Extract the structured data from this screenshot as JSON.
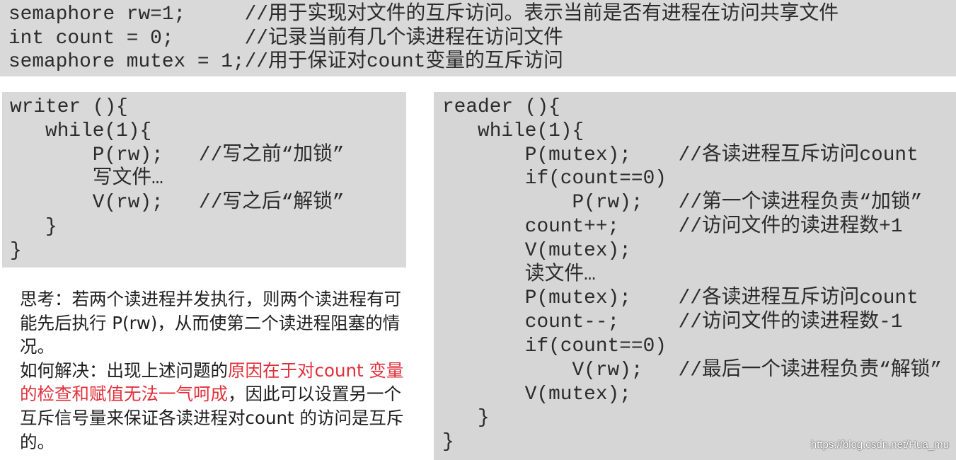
{
  "declarations": [
    "semaphore rw=1;     //用于实现对文件的互斥访问。表示当前是否有进程在访问共享文件",
    "int count = 0;      //记录当前有几个读进程在访问文件",
    "semaphore mutex = 1;//用于保证对count变量的互斥访问"
  ],
  "writer": [
    "writer (){",
    "   while(1){",
    "       P(rw);   //写之前“加锁”",
    "       写文件…",
    "       V(rw);   //写之后“解锁”",
    "   }",
    "}"
  ],
  "reader": [
    "reader (){",
    "   while(1){",
    "       P(mutex);    //各读进程互斥访问count",
    "       if(count==0)",
    "           P(rw);   //第一个读进程负责“加锁”",
    "       count++;     //访问文件的读进程数+1",
    "       V(mutex);",
    "       读文件…",
    "       P(mutex);    //各读进程互斥访问count",
    "       count--;     //访问文件的读进程数-1",
    "       if(count==0)",
    "           V(rw);   //最后一个读进程负责“解锁”",
    "       V(mutex);",
    "   }",
    "}"
  ],
  "note": {
    "part1": "思考：若两个读进程并发执行，则两个读进程有可能先后执行 P(rw)，从而使第二个读进程阻塞的情况。",
    "part2": "如何解决：出现上述问题的",
    "highlight": "原因在于对count 变量的检查和赋值无法一气呵成",
    "part3": "，因此可以设置另一个互斥信号量来保证各读进程对count 的访问是互斥的。"
  },
  "watermark": "https://blog.csdn.net/Hua_mu",
  "colors": {
    "box": "#d9d9d9",
    "highlight": "#e0303a"
  }
}
